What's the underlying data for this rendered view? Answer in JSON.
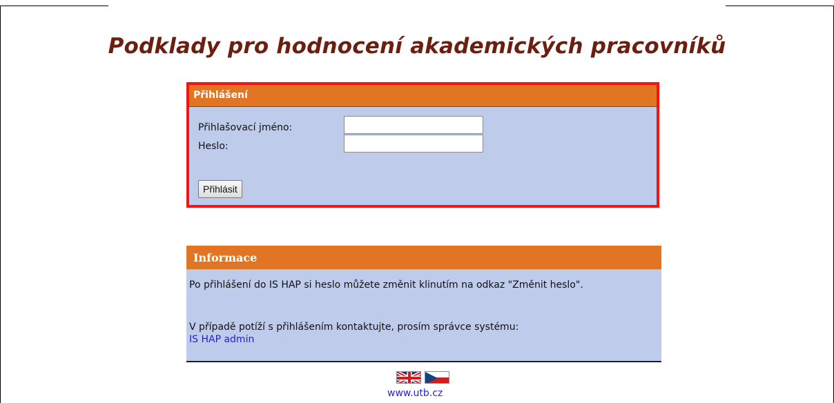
{
  "page": {
    "title": "Podklady pro hodnocení akademických pracovníků"
  },
  "login": {
    "header": "Přihlášení",
    "username_label": "Přihlašovací jméno:",
    "password_label": "Heslo:",
    "username_value": "",
    "password_value": "",
    "submit_label": "Přihlásit"
  },
  "info": {
    "header": "Informace",
    "paragraph_1": "Po přihlášení do IS HAP si heslo můžete změnit klinutím na odkaz \"Změnit heslo\".",
    "paragraph_2": "V případě potíží s přihlášením kontaktujte, prosím správce systému:",
    "admin_link": "IS HAP admin"
  },
  "footer": {
    "languages": [
      "english-flag",
      "czech-flag"
    ],
    "site_link": "www.utb.cz"
  },
  "colors": {
    "panel_header": "#e27523",
    "panel_background": "#bfcbea",
    "active_border": "#ff1010",
    "title": "#6a1f10",
    "link": "#1f1fd8"
  }
}
